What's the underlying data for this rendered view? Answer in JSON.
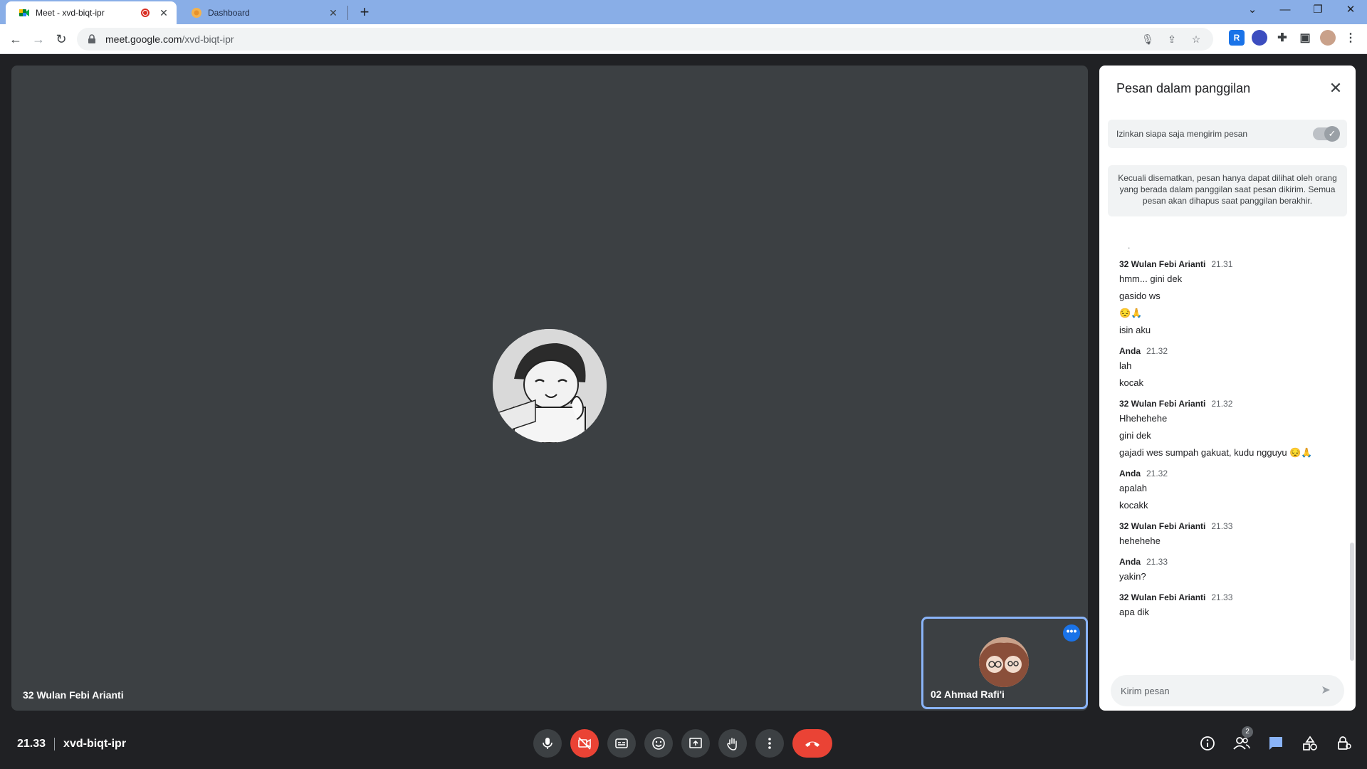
{
  "browser": {
    "tabs": [
      {
        "title": "Meet - xvd-biqt-ipr",
        "recording": true
      },
      {
        "title": "Dashboard"
      }
    ],
    "url_host": "meet.google.com",
    "url_path": "/xvd-biqt-ipr",
    "extensions": [
      "R"
    ]
  },
  "meet": {
    "main_participant": "32 Wulan Febi Arianti",
    "self_participant": "02 Ahmad Rafi'i",
    "time": "21.33",
    "meeting_code": "xvd-biqt-ipr",
    "participant_count": "2",
    "accent_color": "#1a73e8",
    "end_call_color": "#ea4335"
  },
  "chat": {
    "title": "Pesan dalam panggilan",
    "allow_label": "Izinkan siapa saja mengirim pesan",
    "notice": "Kecuali disematkan, pesan hanya dapat dilihat oleh orang yang berada dalam panggilan saat pesan dikirim. Semua pesan akan dihapus saat panggilan berakhir.",
    "stray": ".",
    "messages": [
      {
        "sender": "32 Wulan Febi Arianti",
        "time": "21.31",
        "lines": [
          "hmm... gini dek",
          "gasido ws",
          "😔🙏",
          "isin aku"
        ]
      },
      {
        "sender": "Anda",
        "time": "21.32",
        "lines": [
          "lah",
          "kocak"
        ]
      },
      {
        "sender": "32 Wulan Febi Arianti",
        "time": "21.32",
        "lines": [
          "Hhehehehe",
          "gini dek",
          "gajadi wes sumpah gakuat, kudu ngguyu 😔🙏"
        ]
      },
      {
        "sender": "Anda",
        "time": "21.32",
        "lines": [
          "apalah",
          "kocakk"
        ]
      },
      {
        "sender": "32 Wulan Febi Arianti",
        "time": "21.33",
        "lines": [
          "hehehehe"
        ]
      },
      {
        "sender": "Anda",
        "time": "21.33",
        "lines": [
          "yakin?"
        ]
      },
      {
        "sender": "32 Wulan Febi Arianti",
        "time": "21.33",
        "lines": [
          "apa dik"
        ]
      }
    ],
    "compose_placeholder": "Kirim pesan"
  }
}
